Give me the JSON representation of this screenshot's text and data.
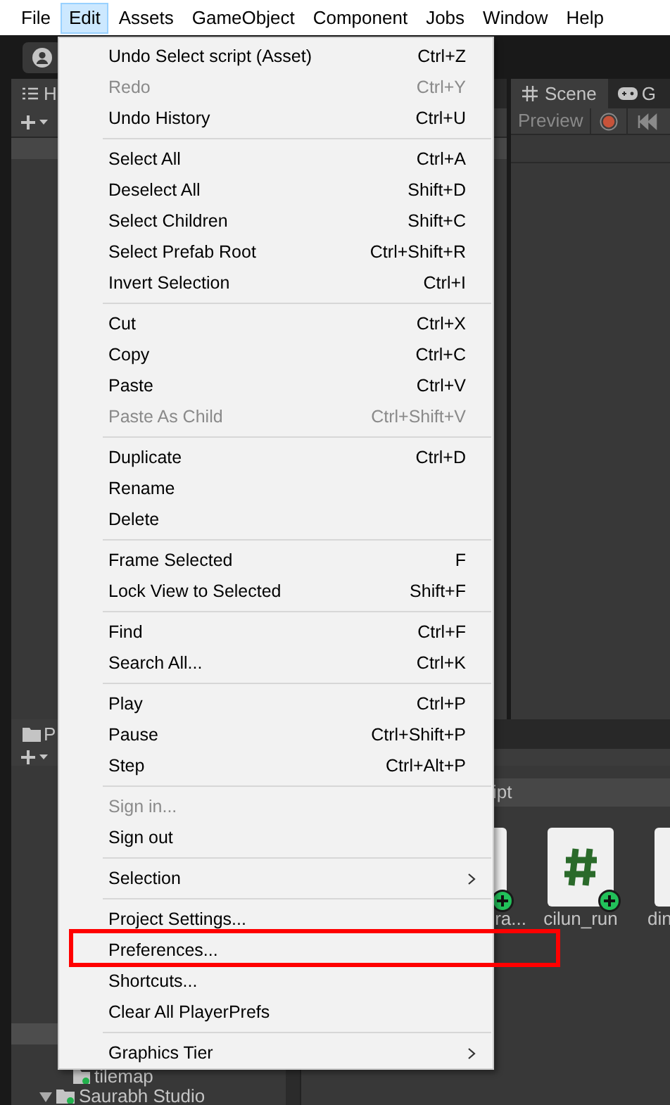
{
  "menubar": [
    {
      "label": "File",
      "selected": false
    },
    {
      "label": "Edit",
      "selected": true
    },
    {
      "label": "Assets",
      "selected": false
    },
    {
      "label": "GameObject",
      "selected": false
    },
    {
      "label": "Component",
      "selected": false
    },
    {
      "label": "Jobs",
      "selected": false
    },
    {
      "label": "Window",
      "selected": false
    },
    {
      "label": "Help",
      "selected": false
    }
  ],
  "hierarchy": {
    "tab": "H"
  },
  "scene": {
    "tabs": [
      "Scene",
      "G"
    ],
    "preview_button": "Preview"
  },
  "project": {
    "tab": "P",
    "header": "ipt",
    "assets": [
      {
        "label": "ra..."
      },
      {
        "label": "cilun_run"
      },
      {
        "label": "din"
      }
    ],
    "tree": [
      "tilemap",
      "Saurabh Studio"
    ]
  },
  "edit_menu": [
    [
      {
        "kind": "command",
        "label": "Undo Select script (Asset)",
        "shortcut": "Ctrl+Z",
        "disabled": false,
        "highlighted": false
      },
      {
        "kind": "command",
        "label": "Redo",
        "shortcut": "Ctrl+Y",
        "disabled": true,
        "highlighted": false
      },
      {
        "kind": "command",
        "label": "Undo History",
        "shortcut": "Ctrl+U",
        "disabled": false,
        "highlighted": false
      }
    ],
    [
      {
        "kind": "command",
        "label": "Select All",
        "shortcut": "Ctrl+A",
        "disabled": false,
        "highlighted": false
      },
      {
        "kind": "command",
        "label": "Deselect All",
        "shortcut": "Shift+D",
        "disabled": false,
        "highlighted": false
      },
      {
        "kind": "command",
        "label": "Select Children",
        "shortcut": "Shift+C",
        "disabled": false,
        "highlighted": false
      },
      {
        "kind": "command",
        "label": "Select Prefab Root",
        "shortcut": "Ctrl+Shift+R",
        "disabled": false,
        "highlighted": false
      },
      {
        "kind": "command",
        "label": "Invert Selection",
        "shortcut": "Ctrl+I",
        "disabled": false,
        "highlighted": false
      }
    ],
    [
      {
        "kind": "command",
        "label": "Cut",
        "shortcut": "Ctrl+X",
        "disabled": false,
        "highlighted": false
      },
      {
        "kind": "command",
        "label": "Copy",
        "shortcut": "Ctrl+C",
        "disabled": false,
        "highlighted": false
      },
      {
        "kind": "command",
        "label": "Paste",
        "shortcut": "Ctrl+V",
        "disabled": false,
        "highlighted": false
      },
      {
        "kind": "command",
        "label": "Paste As Child",
        "shortcut": "Ctrl+Shift+V",
        "disabled": true,
        "highlighted": false
      }
    ],
    [
      {
        "kind": "command",
        "label": "Duplicate",
        "shortcut": "Ctrl+D",
        "disabled": false,
        "highlighted": false
      },
      {
        "kind": "command",
        "label": "Rename",
        "disabled": false,
        "highlighted": false
      },
      {
        "kind": "command",
        "label": "Delete",
        "disabled": false,
        "highlighted": false
      }
    ],
    [
      {
        "kind": "command",
        "label": "Frame Selected",
        "shortcut": "F",
        "disabled": false,
        "highlighted": false
      },
      {
        "kind": "command",
        "label": "Lock View to Selected",
        "shortcut": "Shift+F",
        "disabled": false,
        "highlighted": false
      }
    ],
    [
      {
        "kind": "command",
        "label": "Find",
        "shortcut": "Ctrl+F",
        "disabled": false,
        "highlighted": false
      },
      {
        "kind": "command",
        "label": "Search All...",
        "shortcut": "Ctrl+K",
        "disabled": false,
        "highlighted": false
      }
    ],
    [
      {
        "kind": "command",
        "label": "Play",
        "shortcut": "Ctrl+P",
        "disabled": false,
        "highlighted": false
      },
      {
        "kind": "command",
        "label": "Pause",
        "shortcut": "Ctrl+Shift+P",
        "disabled": false,
        "highlighted": false
      },
      {
        "kind": "command",
        "label": "Step",
        "shortcut": "Ctrl+Alt+P",
        "disabled": false,
        "highlighted": false
      }
    ],
    [
      {
        "kind": "command",
        "label": "Sign in...",
        "disabled": true,
        "highlighted": false
      },
      {
        "kind": "command",
        "label": "Sign out",
        "disabled": false,
        "highlighted": false
      }
    ],
    [
      {
        "kind": "submenu",
        "label": "Selection",
        "disabled": false,
        "highlighted": false
      }
    ],
    [
      {
        "kind": "command",
        "label": "Project Settings...",
        "disabled": false,
        "highlighted": false
      },
      {
        "kind": "command",
        "label": "Preferences...",
        "disabled": false,
        "highlighted": true
      },
      {
        "kind": "command",
        "label": "Shortcuts...",
        "disabled": false,
        "highlighted": false
      },
      {
        "kind": "command",
        "label": "Clear All PlayerPrefs",
        "disabled": false,
        "highlighted": false
      }
    ],
    [
      {
        "kind": "submenu",
        "label": "Graphics Tier",
        "disabled": false,
        "highlighted": false
      }
    ]
  ]
}
